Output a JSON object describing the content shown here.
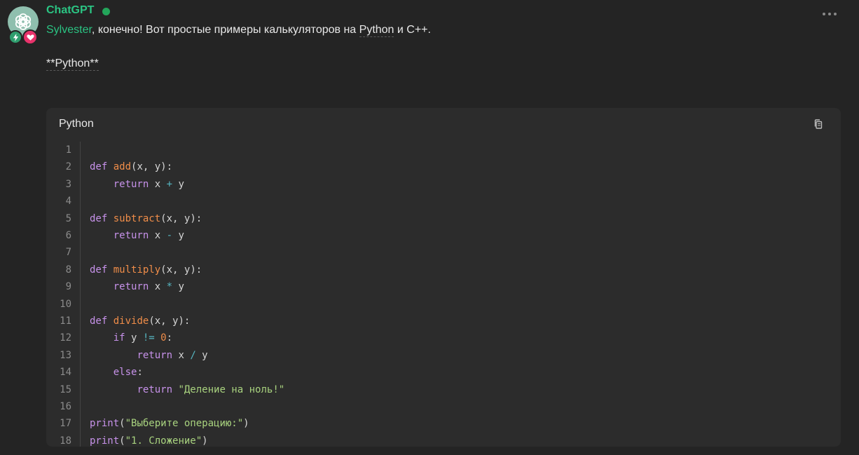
{
  "author": {
    "name": "ChatGPT",
    "status": "online"
  },
  "message": {
    "mention": "Sylvester",
    "text_before": ", конечно! Вот простые примеры калькуляторов на ",
    "python_word": "Python",
    "text_after": " и C++.",
    "heading": "**Python**"
  },
  "code": {
    "language": "Python",
    "copy_icon": "copy-icon",
    "lines": [
      {
        "n": "1",
        "tokens": []
      },
      {
        "n": "2",
        "tokens": [
          [
            "kw",
            "def"
          ],
          [
            "t",
            " "
          ],
          [
            "fn",
            "add"
          ],
          [
            "t",
            "(x, y):"
          ]
        ]
      },
      {
        "n": "3",
        "tokens": [
          [
            "t",
            "    "
          ],
          [
            "kw",
            "return"
          ],
          [
            "t",
            " x "
          ],
          [
            "op",
            "+"
          ],
          [
            "t",
            " y"
          ]
        ]
      },
      {
        "n": "4",
        "tokens": []
      },
      {
        "n": "5",
        "tokens": [
          [
            "kw",
            "def"
          ],
          [
            "t",
            " "
          ],
          [
            "fn",
            "subtract"
          ],
          [
            "t",
            "(x, y):"
          ]
        ]
      },
      {
        "n": "6",
        "tokens": [
          [
            "t",
            "    "
          ],
          [
            "kw",
            "return"
          ],
          [
            "t",
            " x "
          ],
          [
            "op",
            "-"
          ],
          [
            "t",
            " y"
          ]
        ]
      },
      {
        "n": "7",
        "tokens": []
      },
      {
        "n": "8",
        "tokens": [
          [
            "kw",
            "def"
          ],
          [
            "t",
            " "
          ],
          [
            "fn",
            "multiply"
          ],
          [
            "t",
            "(x, y):"
          ]
        ]
      },
      {
        "n": "9",
        "tokens": [
          [
            "t",
            "    "
          ],
          [
            "kw",
            "return"
          ],
          [
            "t",
            " x "
          ],
          [
            "op",
            "*"
          ],
          [
            "t",
            " y"
          ]
        ]
      },
      {
        "n": "10",
        "tokens": []
      },
      {
        "n": "11",
        "tokens": [
          [
            "kw",
            "def"
          ],
          [
            "t",
            " "
          ],
          [
            "fn",
            "divide"
          ],
          [
            "t",
            "(x, y):"
          ]
        ]
      },
      {
        "n": "12",
        "tokens": [
          [
            "t",
            "    "
          ],
          [
            "kw",
            "if"
          ],
          [
            "t",
            " y "
          ],
          [
            "op",
            "!="
          ],
          [
            "t",
            " "
          ],
          [
            "num",
            "0"
          ],
          [
            "t",
            ":"
          ]
        ]
      },
      {
        "n": "13",
        "tokens": [
          [
            "t",
            "        "
          ],
          [
            "kw",
            "return"
          ],
          [
            "t",
            " x "
          ],
          [
            "op",
            "/"
          ],
          [
            "t",
            " y"
          ]
        ]
      },
      {
        "n": "14",
        "tokens": [
          [
            "t",
            "    "
          ],
          [
            "kw",
            "else"
          ],
          [
            "t",
            ":"
          ]
        ]
      },
      {
        "n": "15",
        "tokens": [
          [
            "t",
            "        "
          ],
          [
            "kw",
            "return"
          ],
          [
            "t",
            " "
          ],
          [
            "str",
            "\"Деление на ноль!\""
          ]
        ]
      },
      {
        "n": "16",
        "tokens": []
      },
      {
        "n": "17",
        "tokens": [
          [
            "bi",
            "print"
          ],
          [
            "t",
            "("
          ],
          [
            "str",
            "\"Выберите операцию:\""
          ],
          [
            "t",
            ")"
          ]
        ]
      },
      {
        "n": "18",
        "tokens": [
          [
            "bi",
            "print"
          ],
          [
            "t",
            "("
          ],
          [
            "str",
            "\"1. Сложение\""
          ],
          [
            "t",
            ")"
          ]
        ]
      }
    ]
  },
  "colors": {
    "accent": "#2bc483",
    "background": "#242424",
    "code_background": "#2c2c2c",
    "keyword": "#c792ea",
    "function": "#f08d49",
    "operator": "#56b6c2",
    "string": "#a9d37f"
  }
}
